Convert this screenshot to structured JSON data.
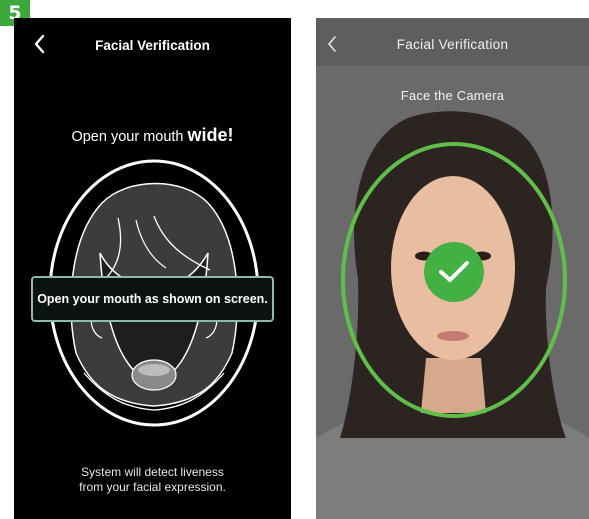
{
  "step_badge": "5",
  "left_screen": {
    "nav_title": "Facial Verification",
    "back_icon": "chevron-left-icon",
    "instruction": {
      "prefix": "Open your mouth ",
      "emphasis": "wide!"
    },
    "banner_text": "Open your mouth as shown on screen.",
    "footer_line1": "System will detect liveness",
    "footer_line2": "from your facial expression.",
    "face_icon": "face-outline-icon"
  },
  "right_screen": {
    "nav_title": "Facial Verification",
    "back_icon": "chevron-left-icon",
    "subtitle": "Face the Camera",
    "check_icon": "checkmark-icon",
    "colors": {
      "oval": "#5fbf4a",
      "check_bg": "#43b043"
    }
  },
  "colors": {
    "badge": "#3aa83a",
    "left_bg": "#000000",
    "banner_border": "#8fb8b2"
  }
}
